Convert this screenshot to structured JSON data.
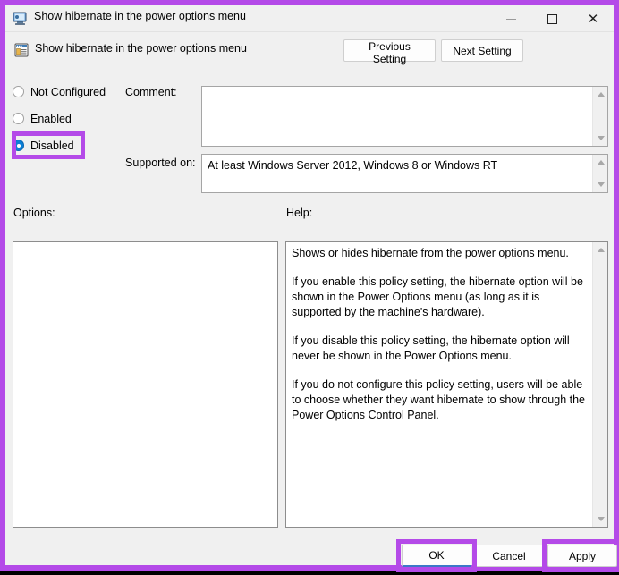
{
  "window": {
    "title": "Show hibernate in the power options menu",
    "title_icon": "monitor-policy-icon",
    "minimize_label": "Minimize",
    "maximize_label": "Maximize",
    "close_label": "Close"
  },
  "sub_header": {
    "policy_icon": "policy-setting-icon",
    "policy_title": "Show hibernate in the power options menu",
    "previous_setting_label": "Previous Setting",
    "next_setting_label": "Next Setting"
  },
  "state_radios": [
    {
      "label": "Not Configured",
      "checked": false
    },
    {
      "label": "Enabled",
      "checked": false
    },
    {
      "label": "Disabled",
      "checked": true
    }
  ],
  "fields": {
    "comment_label": "Comment:",
    "comment_value": "",
    "supported_label": "Supported on:",
    "supported_value": "At least Windows Server 2012, Windows 8 or Windows RT"
  },
  "panels": {
    "options_label": "Options:",
    "options_value": "",
    "help_label": "Help:",
    "help_paragraphs": [
      "Shows or hides hibernate from the power options menu.",
      "If you enable this policy setting, the hibernate option will be shown in the Power Options menu (as long as it is supported by the machine's hardware).",
      "If you disable this policy setting, the hibernate option will never be shown in the Power Options menu.",
      "If you do not configure this policy setting, users will be able to choose whether they want hibernate to show through the Power Options Control Panel."
    ]
  },
  "footer": {
    "ok_label": "OK",
    "cancel_label": "Cancel",
    "apply_label": "Apply"
  },
  "colors": {
    "annotation_purple": "#b44ae8",
    "radio_selected_blue": "#0a7fd6",
    "default_button_underline": "#3b78c8",
    "window_background": "#f0f0f0"
  }
}
